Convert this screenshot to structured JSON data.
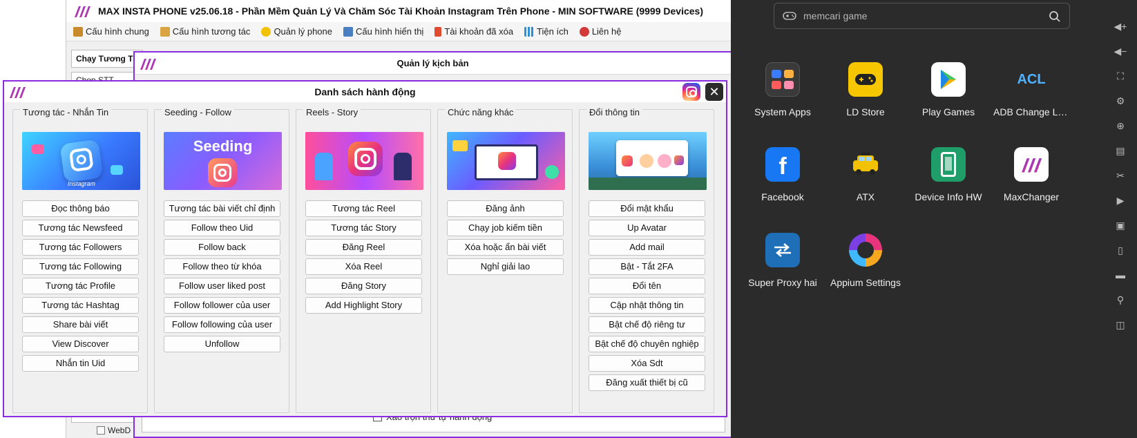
{
  "main_window": {
    "title": "MAX INSTA PHONE v25.06.18 - Phần Mềm Quản Lý Và Chăm Sóc Tài Khoản Instagram Trên Phone - MIN SOFTWARE (9999 Devices)",
    "menu": [
      {
        "label": "Cấu hình chung",
        "icon": "wrench-icon",
        "color": "#c98a2b"
      },
      {
        "label": "Cấu hình tương tác",
        "icon": "settings-icon",
        "color": "#d9a441"
      },
      {
        "label": "Quản lý phone",
        "icon": "phone-icon",
        "color": "#f2c200"
      },
      {
        "label": "Cấu hình hiển thị",
        "icon": "display-icon",
        "color": "#4a7fc1"
      },
      {
        "label": "Tài khoản đã xóa",
        "icon": "trash-icon",
        "color": "#e04b2f"
      },
      {
        "label": "Tiện ích",
        "icon": "grid-icon",
        "color": "#2d8fd5"
      },
      {
        "label": "Liên hệ",
        "icon": "contact-icon",
        "color": "#d23a3a"
      }
    ],
    "side_tab": "Chạy Tương Tá",
    "side_row": "Chọn STT",
    "shuffle_label": "Xáo trộn thứ tự hành động",
    "webd_label": "WebD"
  },
  "kb_window": {
    "title": "Quản lý kịch bản"
  },
  "ds_window": {
    "title": "Danh sách hành động",
    "groups": [
      {
        "label": "Tương tác - Nhắn Tin",
        "banner_text": "Instagram",
        "buttons": [
          "Đọc thông báo",
          "Tương tác Newsfeed",
          "Tương tác Followers",
          "Tương tác Following",
          "Tương tác Profile",
          "Tương tác Hashtag",
          "Share bài viết",
          "View Discover",
          "Nhắn tin Uid"
        ]
      },
      {
        "label": "Seeding - Follow",
        "banner_text": "Seeding",
        "buttons": [
          "Tương tác bài viết chỉ định",
          "Follow theo Uid",
          "Follow back",
          "Follow theo từ khóa",
          "Follow user liked post",
          "Follow follower của user",
          "Follow following của user",
          "Unfollow"
        ]
      },
      {
        "label": "Reels - Story",
        "banner_text": "",
        "buttons": [
          "Tương tác Reel",
          "Tương tác Story",
          "Đăng Reel",
          "Xóa Reel",
          "Đăng Story",
          "Add Highlight Story"
        ]
      },
      {
        "label": "Chức năng khác",
        "banner_text": "",
        "buttons": [
          "Đăng ảnh",
          "Chạy job kiếm tiền",
          "Xóa hoặc ẩn bài viết",
          "Nghỉ giải lao"
        ]
      },
      {
        "label": "Đổi thông tin",
        "banner_text": "",
        "buttons": [
          "Đổi mật khẩu",
          "Up Avatar",
          "Add mail",
          "Bật - Tắt 2FA",
          "Đổi tên",
          "Cập nhật thông tin",
          "Bật chế độ riêng tư",
          "Bật chế độ chuyên nghiệp",
          "Xóa Sdt",
          "Đăng xuất thiết bị cũ"
        ]
      }
    ]
  },
  "emulator": {
    "search_placeholder": "memcari game",
    "apps": [
      {
        "label": "System Apps",
        "icon": "system-apps-icon"
      },
      {
        "label": "LD Store",
        "icon": "ld-store-icon"
      },
      {
        "label": "Play Games",
        "icon": "play-games-icon"
      },
      {
        "label": "ADB Change Language",
        "icon": "acl-icon",
        "icon_text": "ACL"
      },
      {
        "label": "Facebook",
        "icon": "facebook-icon"
      },
      {
        "label": "ATX",
        "icon": "atx-icon"
      },
      {
        "label": "Device Info HW",
        "icon": "device-info-icon"
      },
      {
        "label": "MaxChanger",
        "icon": "maxchanger-icon"
      },
      {
        "label": "Super Proxy hai",
        "icon": "super-proxy-icon"
      },
      {
        "label": "Appium Settings",
        "icon": "appium-icon"
      }
    ]
  }
}
